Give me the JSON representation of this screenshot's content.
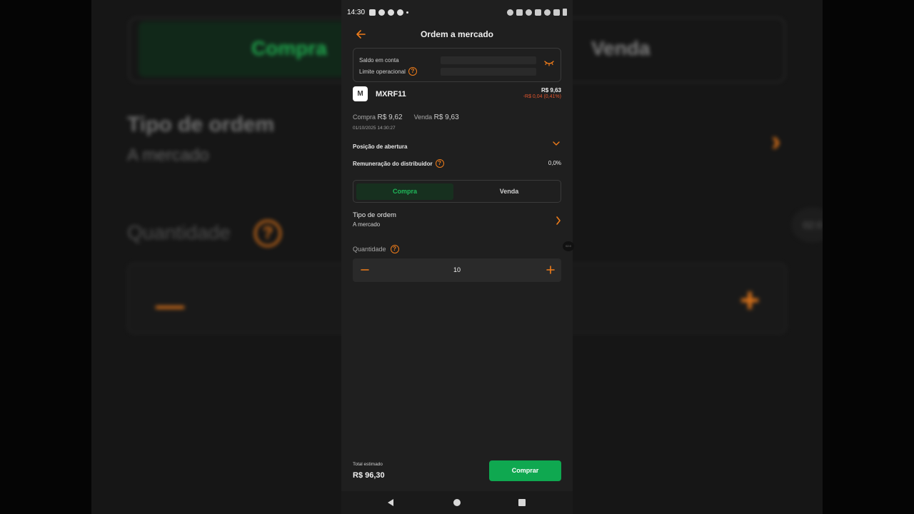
{
  "background": {
    "compra_label": "Compra",
    "venda_label": "Venda",
    "tipo_label": "Tipo de ordem",
    "tipo_value": "A mercado",
    "quantidade_label": "Quantidade",
    "help_glyph": "?",
    "minus_glyph": "—",
    "plus_glyph": "+",
    "chevron_glyph": "›",
    "timer": "02:0"
  },
  "status_bar": {
    "time": "14:30"
  },
  "header": {
    "title": "Ordem a mercado",
    "back_icon": "arrow-left-icon"
  },
  "balance": {
    "saldo_label": "Saldo em conta",
    "limite_label": "Limite operacional",
    "help_glyph": "?",
    "eye_icon": "eye-closed-icon"
  },
  "asset": {
    "logo_letter": "M",
    "ticker": "MXRF11",
    "price": "R$ 9,63",
    "change": "-R$ 0,04 (0,41%)"
  },
  "quote": {
    "buy_label": "Compra",
    "buy_value": "R$ 9,62",
    "sell_label": "Venda",
    "sell_value": "R$ 9,63",
    "datetime": "01/10/2025 14:30:27"
  },
  "position": {
    "label": "Posição de abertura"
  },
  "remuneration": {
    "label": "Remuneração do distribuidor",
    "value": "0,0%",
    "help_glyph": "?"
  },
  "segment": {
    "buy_label": "Compra",
    "sell_label": "Venda",
    "selected": "Compra"
  },
  "order_type": {
    "label": "Tipo de ordem",
    "value": "A mercado"
  },
  "timer_badge": "02:0",
  "quantity": {
    "label": "Quantidade",
    "value": "10",
    "help_glyph": "?"
  },
  "total": {
    "label": "Total estimado",
    "value": "R$ 96,30"
  },
  "buy_button": {
    "label": "Comprar"
  },
  "colors": {
    "accent_orange": "#ef7c1a",
    "buy_green": "#0fa850",
    "negative_red": "#e2552d",
    "background": "#1f1f1f"
  }
}
